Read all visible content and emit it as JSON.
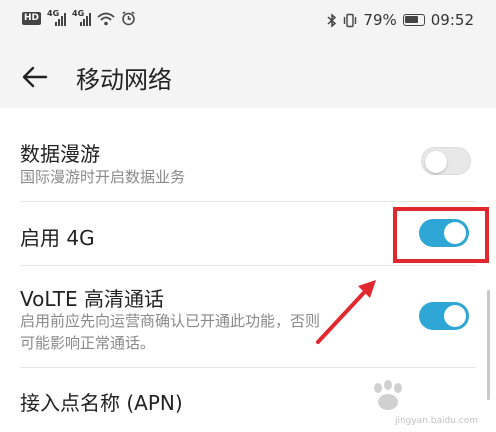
{
  "status_bar": {
    "hd_label": "HD",
    "sim1_label": "4G",
    "sim2_label": "4G",
    "battery_percent": "79%",
    "time": "09:52"
  },
  "header": {
    "title": "移动网络",
    "back_icon": "arrow-left-icon"
  },
  "settings": [
    {
      "title": "数据漫游",
      "subtitle": "国际漫游时开启数据业务",
      "enabled": false
    },
    {
      "title": "启用 4G",
      "subtitle": "",
      "enabled": true
    },
    {
      "title": "VoLTE 高清通话",
      "subtitle_line1": "启用前应先向运营商确认已开通此功能，否则",
      "subtitle_line2": "可能影响正常通话。",
      "enabled": true
    },
    {
      "title": "接入点名称 (APN)"
    }
  ],
  "colors": {
    "toggle_on": "#2ea6d6",
    "toggle_off": "#e8e8e8",
    "annotation_red": "#e0282e"
  },
  "watermark": {
    "text": "jingyan.baidu.com"
  }
}
